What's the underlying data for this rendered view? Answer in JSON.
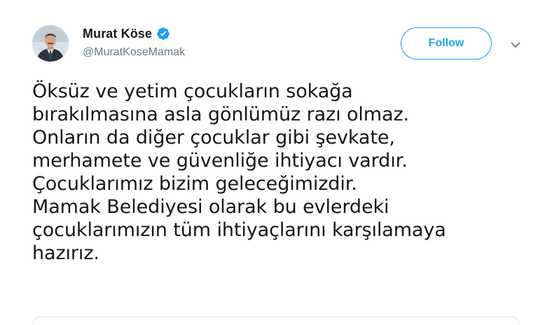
{
  "user": {
    "display_name": "Murat Köse",
    "handle": "@MuratKoseMamak",
    "verified": true,
    "avatar_icon": "profile-photo"
  },
  "actions": {
    "follow_label": "Follow",
    "more_icon": "chevron-down-icon"
  },
  "tweet": {
    "lines": [
      "Öksüz ve yetim çocukların sokağa",
      "bırakılmasına asla gönlümüz razı olmaz.",
      "Onların da diğer çocuklar gibi şevkate,",
      "merhamete ve güvenliğe ihtiyacı vardır.",
      "Çocuklarımız bizim geleceğimizdir.",
      "Mamak Belediyesi olarak bu evlerdeki",
      "çocuklarımızın tüm ihtiyaçlarını karşılamaya",
      "hazırız."
    ]
  },
  "colors": {
    "accent": "#1da1f2",
    "text": "#14171a",
    "secondary_text": "#657786",
    "border": "#e1e8ed"
  }
}
